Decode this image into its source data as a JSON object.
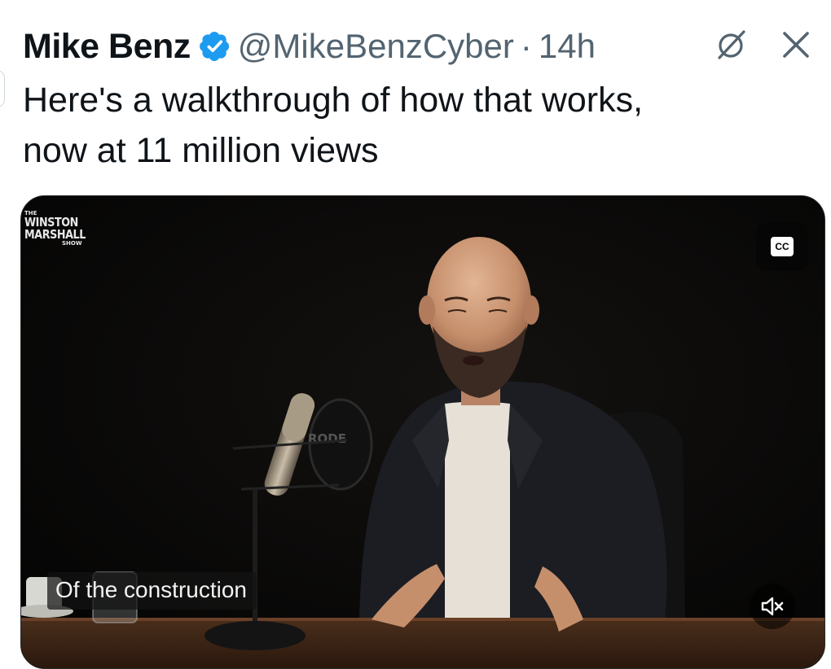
{
  "author": {
    "display_name": "Mike Benz",
    "handle": "@MikeBenzCyber",
    "separator": "·",
    "time": "14h"
  },
  "tweet": {
    "line1": "Here's a walkthrough of how that works,",
    "line2": "now at 11 million views"
  },
  "video": {
    "logo_the": "THE",
    "logo_winston": "WINSTON",
    "logo_marshall": "MARSHALL",
    "logo_show": "SHOW",
    "mic_brand": "RODE",
    "cc_label": "CC",
    "caption": "Of the construction",
    "muted": true
  },
  "icons": {
    "verified": "verified-badge-icon",
    "grok": "grok-icon",
    "close": "close-icon",
    "mute": "speaker-muted-icon"
  },
  "colors": {
    "verified_blue": "#1d9bf0",
    "text_primary": "#0f1419",
    "text_secondary": "#536471"
  }
}
